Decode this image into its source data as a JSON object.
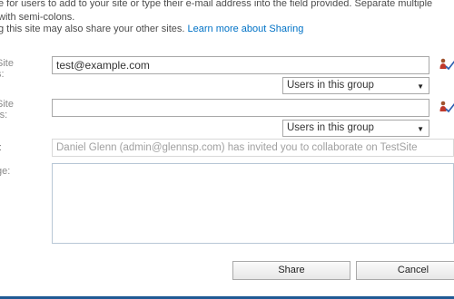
{
  "intro": {
    "line1": "e for users to add to your site or type their e-mail address into the field provided. Separate multiple",
    "line2": "with semi-colons.",
    "line3": "g this site may also share your other sites.",
    "learn_more": "Learn more about Sharing"
  },
  "form": {
    "users_label_1": "Site",
    "users_label_2": "s:",
    "users_value": "test@example.com",
    "users_group": "Users in this group",
    "owners_label_1": "Site",
    "owners_label_2": "rs:",
    "owners_value": "",
    "owners_group": "Users in this group",
    "subject_label": "t:",
    "subject_value": "Daniel Glenn (admin@glennsp.com) has invited you to collaborate on TestSite",
    "message_label": "ge:"
  },
  "buttons": {
    "share": "Share",
    "cancel": "Cancel"
  },
  "colors": {
    "link": "#0072c6",
    "footer_bar": "#1f5a94"
  },
  "icons": {
    "check_names": "people-check-icon",
    "dropdown": "chevron-down-icon"
  }
}
